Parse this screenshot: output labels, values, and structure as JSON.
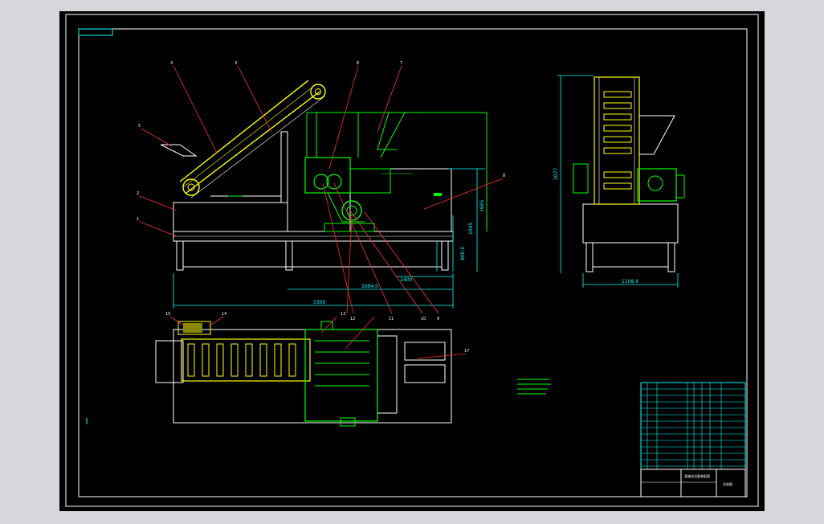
{
  "colors": {
    "background": "#000000",
    "frame": "#ffffff",
    "outline": "#ffffff",
    "body": "#00ff00",
    "dimension": "#00ffff",
    "detail": "#ffff00",
    "leader": "#ff0000",
    "page": "#d5d7dc"
  },
  "dimensions": {
    "height_front": "1685",
    "height_mid": "1045",
    "height_frame": "800.0",
    "width_right_part": "1400",
    "width_mid": "1694.0",
    "width_total": "5300",
    "height_side": "3077",
    "width_side": "1108.4"
  },
  "part_numbers": {
    "front_view": [
      "4",
      "3",
      "5",
      "2",
      "1",
      "6",
      "7",
      "8",
      "9",
      "10",
      "11",
      "12",
      "13"
    ],
    "top_view": [
      "15",
      "14",
      "17"
    ]
  },
  "title_block": {
    "drawing_name": "某输送设备装配图",
    "sheet_label": "总装图"
  }
}
